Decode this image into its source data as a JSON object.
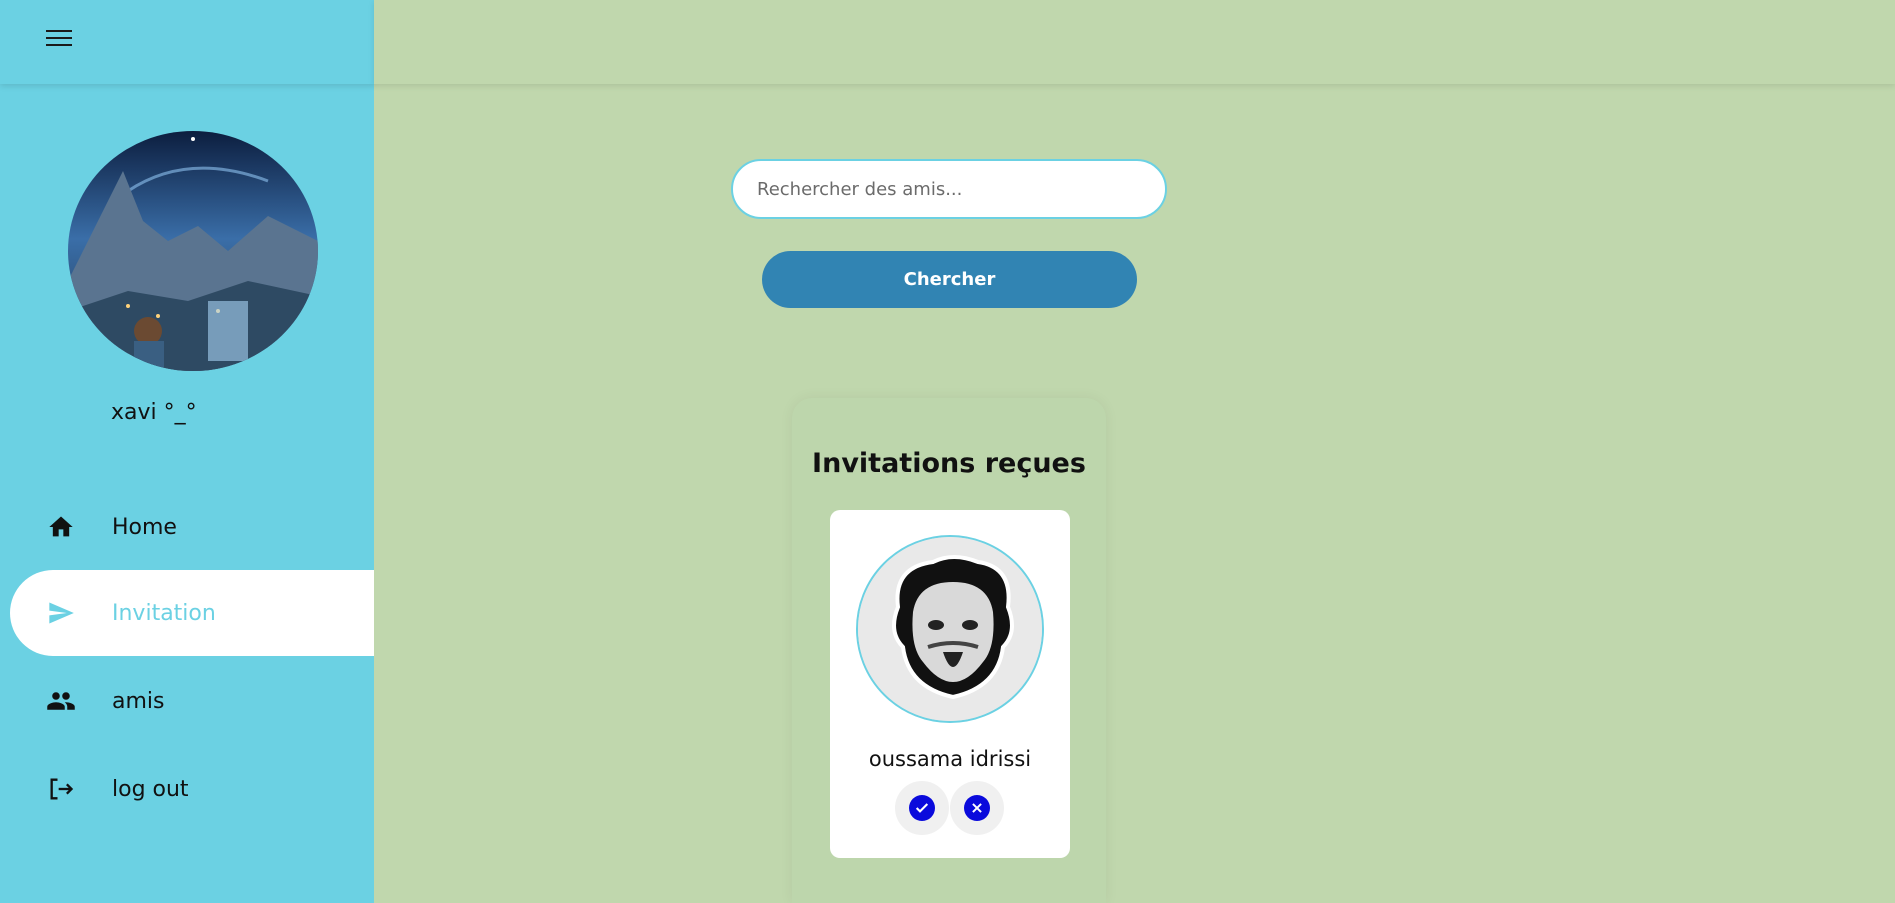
{
  "sidebar": {
    "username": "xavi °_°",
    "items": [
      {
        "label": "Home",
        "icon": "home-icon"
      },
      {
        "label": "Invitation",
        "icon": "send-icon"
      },
      {
        "label": "amis",
        "icon": "people-icon"
      },
      {
        "label": "log out",
        "icon": "logout-icon"
      }
    ],
    "active_index": 1
  },
  "search": {
    "placeholder": "Rechercher des amis...",
    "button_label": "Chercher"
  },
  "invitations": {
    "title": "Invitations reçues",
    "items": [
      {
        "name": "oussama idrissi",
        "accept_icon": "check-icon",
        "decline_icon": "close-icon"
      }
    ]
  },
  "colors": {
    "sidebar": "#6bd1e3",
    "main_bg": "#c0d7ad",
    "button": "#3184b3",
    "action": "#0a0adc"
  }
}
